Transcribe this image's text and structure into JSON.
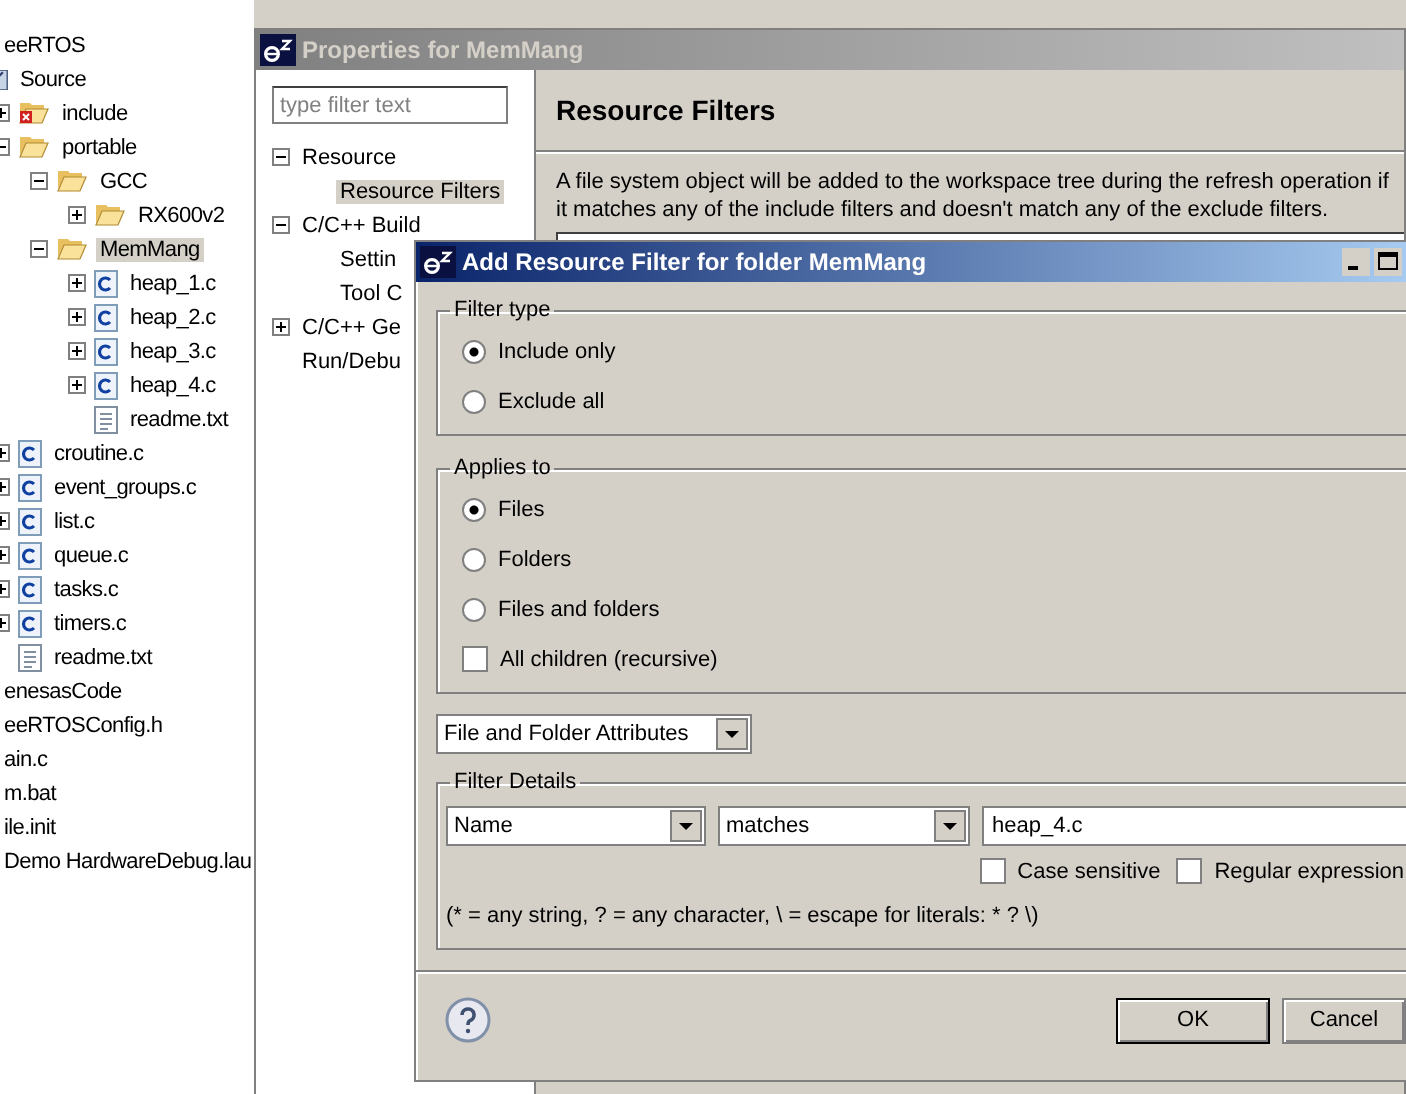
{
  "explorer": {
    "items": [
      {
        "label": "eeRTOS",
        "selected": false,
        "children": [
          {
            "label": "Source",
            "kind": "source-folder",
            "selected": false,
            "children": [
              {
                "label": "include",
                "kind": "include-folder",
                "expanded": false,
                "selected": false
              },
              {
                "label": "portable",
                "kind": "folder",
                "expanded": true,
                "selected": false,
                "children": [
                  {
                    "label": "GCC",
                    "kind": "folder",
                    "expanded": true,
                    "selected": false,
                    "children": [
                      {
                        "label": "RX600v2",
                        "kind": "folder",
                        "expanded": false,
                        "selected": false
                      }
                    ]
                  },
                  {
                    "label": "MemMang",
                    "kind": "folder",
                    "expanded": true,
                    "selected": true,
                    "children": [
                      {
                        "label": "heap_1.c",
                        "kind": "c-file",
                        "expanded": false,
                        "selected": false
                      },
                      {
                        "label": "heap_2.c",
                        "kind": "c-file",
                        "expanded": false,
                        "selected": false
                      },
                      {
                        "label": "heap_3.c",
                        "kind": "c-file",
                        "expanded": false,
                        "selected": false
                      },
                      {
                        "label": "heap_4.c",
                        "kind": "c-file",
                        "expanded": false,
                        "selected": false
                      },
                      {
                        "label": "readme.txt",
                        "kind": "text-file",
                        "selected": false
                      }
                    ]
                  }
                ]
              },
              {
                "label": "croutine.c",
                "kind": "c-file",
                "expanded": false,
                "selected": false
              },
              {
                "label": "event_groups.c",
                "kind": "c-file",
                "expanded": false,
                "selected": false
              },
              {
                "label": "list.c",
                "kind": "c-file",
                "expanded": false,
                "selected": false
              },
              {
                "label": "queue.c",
                "kind": "c-file",
                "expanded": false,
                "selected": false
              },
              {
                "label": "tasks.c",
                "kind": "c-file",
                "expanded": false,
                "selected": false
              },
              {
                "label": "timers.c",
                "kind": "c-file",
                "expanded": false,
                "selected": false
              },
              {
                "label": "readme.txt",
                "kind": "text-file",
                "selected": false
              }
            ]
          }
        ]
      },
      {
        "label": "enesasCode",
        "selected": false
      },
      {
        "label": "eeRTOSConfig.h",
        "selected": false
      },
      {
        "label": "ain.c",
        "selected": false
      },
      {
        "label": "m.bat",
        "selected": false
      },
      {
        "label": "ile.init",
        "selected": false
      },
      {
        "label": "Demo HardwareDebug.lau",
        "selected": false
      }
    ]
  },
  "properties": {
    "title": "Properties for MemMang",
    "filter": {
      "placeholder": "type filter text"
    },
    "pages": [
      {
        "label": "Resource",
        "expanded": true,
        "selected": false,
        "children": [
          {
            "label": "Resource Filters",
            "selected": true
          }
        ]
      },
      {
        "label": "C/C++ Build",
        "expanded": true,
        "selected": false,
        "children": [
          {
            "label": "Settin",
            "selected": false
          },
          {
            "label": "Tool C",
            "selected": false
          }
        ]
      },
      {
        "label": "C/C++ Ge",
        "expanded": false,
        "selected": false
      },
      {
        "label": "Run/Debu",
        "selected": false
      }
    ],
    "heading": "Resource Filters",
    "description": "A file system object will be added to the workspace tree during the refresh operation if it matches any of the include filters and doesn't match any of the exclude filters."
  },
  "dialog": {
    "title": "Add Resource Filter for folder MemMang",
    "filter_type": {
      "label": "Filter type",
      "options": [
        {
          "label": "Include only",
          "selected": true
        },
        {
          "label": "Exclude all",
          "selected": false
        }
      ]
    },
    "applies_to": {
      "label": "Applies to",
      "options": [
        {
          "label": "Files",
          "selected": true
        },
        {
          "label": "Folders",
          "selected": false
        },
        {
          "label": "Files and folders",
          "selected": false
        }
      ],
      "recursive": {
        "label": "All children (recursive)",
        "checked": false
      }
    },
    "attribute_kind": "File and Folder Attributes",
    "details": {
      "label": "Filter Details",
      "attribute": "Name",
      "operator": "matches",
      "value": "heap_4.c",
      "options": [
        {
          "label": "Case sensitive",
          "checked": false
        },
        {
          "label": "Regular expression",
          "checked": false
        }
      ],
      "hint": "(* = any string, ? = any character, \\ = escape for literals: * ? \\)"
    },
    "buttons": [
      {
        "label": "OK",
        "default": true
      },
      {
        "label": "Cancel",
        "default": false
      }
    ]
  }
}
